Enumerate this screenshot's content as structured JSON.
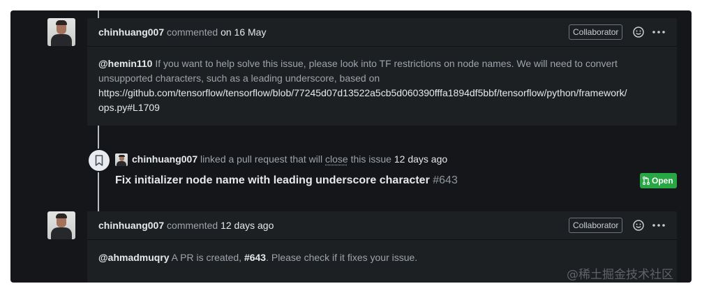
{
  "comments": [
    {
      "author": "chinhuang007",
      "action": "commented",
      "date": "on 16 May",
      "badge": "Collaborator",
      "body": {
        "mention": "@hemin110",
        "line1_rest": " If you want to help solve this issue, please look into TF restrictions on node names. We will need to convert",
        "line2": "unsupported characters, such as a leading underscore, based on",
        "link_line1": "https://github.com/tensorflow/tensorflow/blob/77245d07d13522a5cb5d060390fffa1894df5bbf/tensorflow/python/framework/",
        "link_line2": "ops.py#L1709"
      }
    },
    {
      "author": "chinhuang007",
      "action": "commented",
      "date": "12 days ago",
      "badge": "Collaborator",
      "body": {
        "mention": "@ahmadmuqry",
        "text1": " A PR is created, ",
        "pr_ref": "#643",
        "text2": ". Please check if it fixes your issue."
      }
    }
  ],
  "event": {
    "icon": "bookmark-icon",
    "author": "chinhuang007",
    "text_before": "linked a pull request that will",
    "close_word": "close",
    "text_after": "this issue",
    "time": "12 days ago",
    "pr_title": "Fix initializer node name with leading underscore character",
    "pr_number": "#643",
    "status": "Open",
    "status_color": "#28a745"
  },
  "icons": {
    "emoji": "smiley-icon",
    "more": "kebab-horizontal-icon",
    "pr": "git-pull-request-icon"
  },
  "watermark": "@稀土掘金技术社区"
}
